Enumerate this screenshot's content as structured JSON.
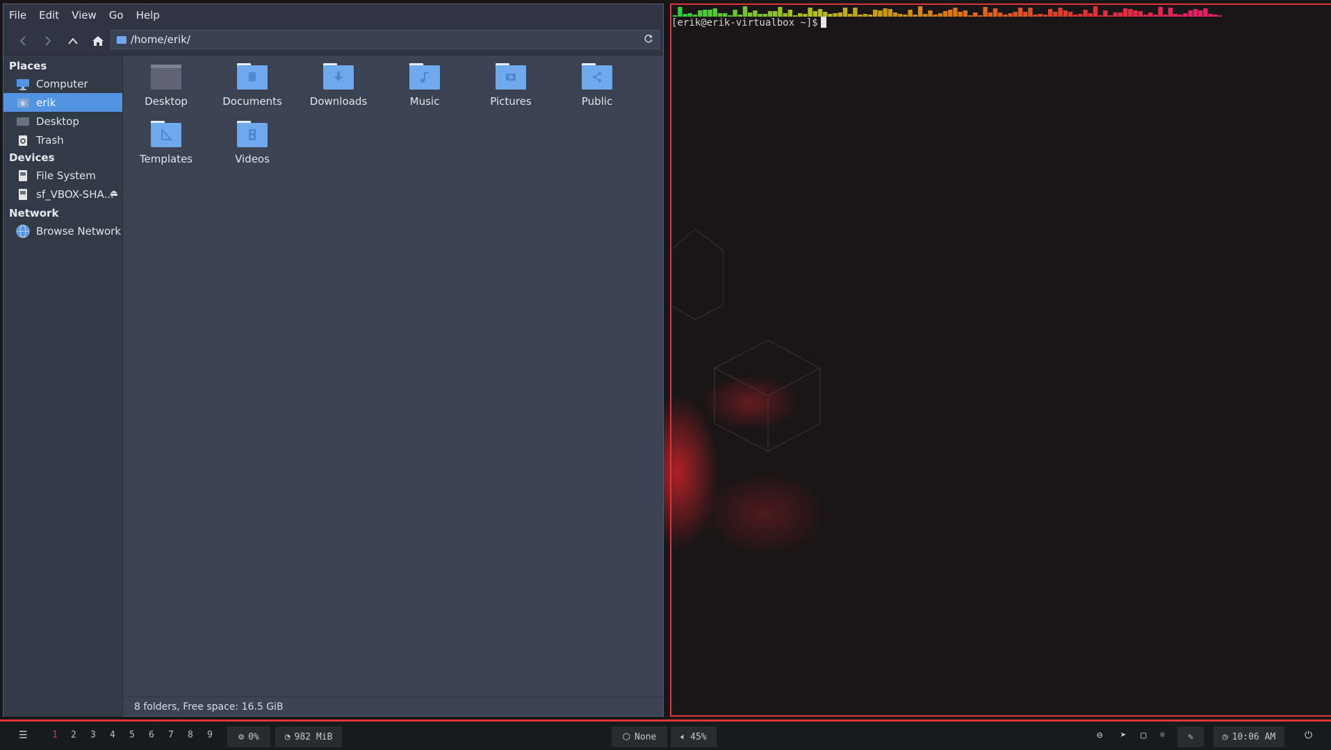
{
  "file_manager": {
    "menu": [
      "File",
      "Edit",
      "View",
      "Go",
      "Help"
    ],
    "toolbar_icons": [
      "back-icon",
      "forward-icon",
      "up-icon",
      "home-icon"
    ],
    "path": "/home/erik/",
    "sidebar": {
      "places_title": "Places",
      "places": [
        {
          "label": "Computer",
          "icon": "computer-icon"
        },
        {
          "label": "erik",
          "icon": "home-folder-icon",
          "selected": true
        },
        {
          "label": "Desktop",
          "icon": "desktop-folder-icon"
        },
        {
          "label": "Trash",
          "icon": "trash-icon"
        }
      ],
      "devices_title": "Devices",
      "devices": [
        {
          "label": "File System",
          "icon": "drive-icon"
        },
        {
          "label": "sf_VBOX-SHA...",
          "icon": "drive-icon",
          "eject": "⏏"
        }
      ],
      "network_title": "Network",
      "network": [
        {
          "label": "Browse Network",
          "icon": "network-icon"
        }
      ]
    },
    "files": [
      {
        "name": "Desktop",
        "icon": "desktop-folder-icon"
      },
      {
        "name": "Documents",
        "icon": "documents-folder-icon"
      },
      {
        "name": "Downloads",
        "icon": "downloads-folder-icon"
      },
      {
        "name": "Music",
        "icon": "music-folder-icon"
      },
      {
        "name": "Pictures",
        "icon": "pictures-folder-icon"
      },
      {
        "name": "Public",
        "icon": "public-folder-icon"
      },
      {
        "name": "Templates",
        "icon": "templates-folder-icon"
      },
      {
        "name": "Videos",
        "icon": "videos-folder-icon"
      }
    ],
    "status": "8 folders, Free space: 16.5 GiB"
  },
  "terminal": {
    "prompt": "[erik@erik-virtualbox ~]$"
  },
  "panel": {
    "workspaces": [
      "1",
      "2",
      "3",
      "4",
      "5",
      "6",
      "7",
      "8",
      "9"
    ],
    "active_workspace": "1",
    "cpu": "0%",
    "memory": "982 MiB",
    "network": "None",
    "volume": "45%",
    "clock": "10:06 AM",
    "accent": "#e0343a"
  },
  "colors": {
    "selection": "#5294e2",
    "folder": "#6fa8ec",
    "terminal_border": "#e0343a"
  }
}
